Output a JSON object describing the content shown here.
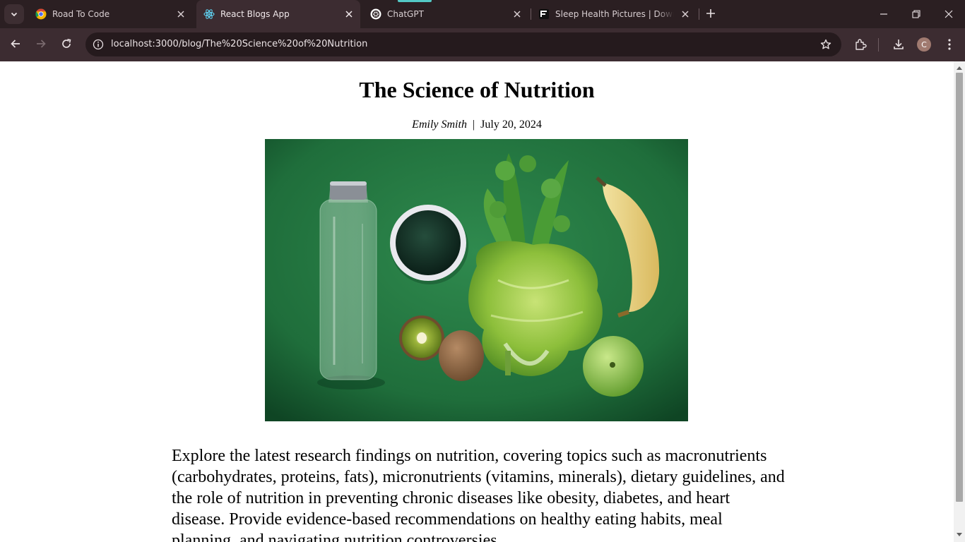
{
  "browser": {
    "tabs": [
      {
        "title": "Road To Code",
        "icon": "chrome-dev-icon",
        "active": false
      },
      {
        "title": "React Blogs App",
        "icon": "react-icon",
        "active": true
      },
      {
        "title": "ChatGPT",
        "icon": "openai-icon",
        "active": false
      },
      {
        "title": "Sleep Health Pictures | Downloa",
        "icon": "freepik-icon",
        "active": false
      }
    ],
    "url": "localhost:3000/blog/The%20Science%20of%20Nutrition",
    "profile_initial": "C",
    "colors": {
      "titlebar": "#2b1f22",
      "toolbar": "#3c2c31",
      "accent": "#53c8c5"
    }
  },
  "post": {
    "title": "The Science of Nutrition",
    "author": "Emily Smith",
    "separator": "|",
    "date": "July 20, 2024",
    "image": {
      "subject": "water bottle, bowl of green powder, kiwis, lettuce and celery, banana and green apple on a green background"
    },
    "body": "Explore the latest research findings on nutrition, covering topics such as macronutrients (carbohydrates, proteins, fats), micronutrients (vitamins, minerals), dietary guidelines, and the role of nutrition in preventing chronic diseases like obesity, diabetes, and heart disease. Provide evidence-based recommendations on healthy eating habits, meal planning, and navigating nutrition controversies."
  }
}
